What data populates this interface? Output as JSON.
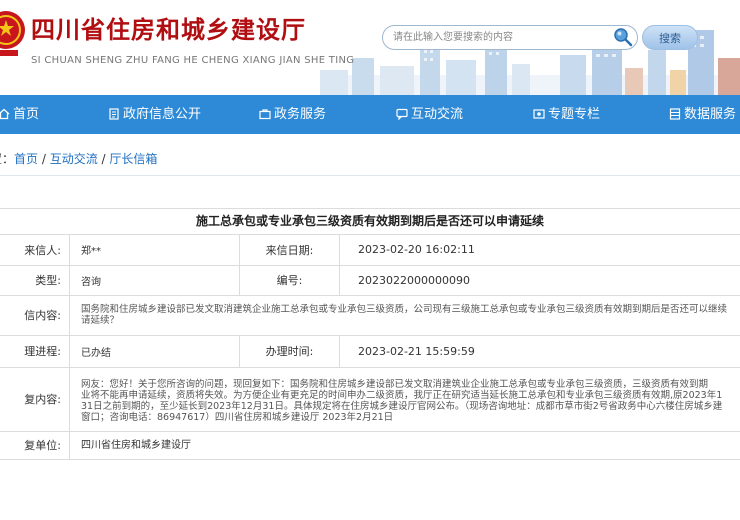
{
  "header": {
    "title": "四川省住房和城乡建设厅",
    "pinyin": "SI CHUAN SHENG ZHU FANG HE CHENG XIANG JIAN SHE TING",
    "search_placeholder": "请在此输入您要搜索的内容",
    "search_button": "搜索"
  },
  "nav": [
    {
      "label": "首页",
      "icon": "home-icon"
    },
    {
      "label": "政府信息公开",
      "icon": "document-icon"
    },
    {
      "label": "政务服务",
      "icon": "briefcase-icon"
    },
    {
      "label": "互动交流",
      "icon": "chat-icon"
    },
    {
      "label": "专题专栏",
      "icon": "star-icon"
    },
    {
      "label": "数据服务",
      "icon": "database-icon"
    }
  ],
  "breadcrumb": {
    "prefix": "置：",
    "items": [
      "首页",
      "互动交流",
      "厅长信箱"
    ],
    "separator": " / "
  },
  "letter": {
    "title": "施工总承包或专业承包三级资质有效期到期后是否还可以申请延续",
    "sender_label": "来信人:",
    "sender": "郑**",
    "date_label": "来信日期:",
    "date": "2023-02-20 16:02:11",
    "type_label": "类型:",
    "type": "咨询",
    "number_label": "编号:",
    "number": "2023022000000090",
    "content_label": "信内容:",
    "content": "国务院和住房城乡建设部已发文取消建筑企业施工总承包或专业承包三级资质，公司现有三级施工总承包或专业承包三级资质有效期到期后是否还可以继续\n请延续？",
    "process_label": "理进程:",
    "process": "已办结",
    "handle_time_label": "办理时间:",
    "handle_time": "2023-02-21 15:59:59",
    "reply_label": "复内容:",
    "reply": "网友：您好！关于您所咨询的问题，现回复如下：国务院和住房城乡建设部已发文取消建筑业企业施工总承包或专业承包三级资质，三级资质有效到期\n业将不能再申请延续，资质将失效。为方便企业有更充足的时间申办二级资质，我厅正在研究适当延长施工总承包和专业承包三级资质有效期,原2023年1\n31日之前到期的，至少延长到2023年12月31日。具体规定将在住房城乡建设厅官网公布。（现场咨询地址：成都市草市街2号省政务中心六楼住房城乡建\n窗口；咨询电话：86947617）四川省住房和城乡建设厅 2023年2月21日",
    "unit_label": "复单位:",
    "unit": "四川省住房和城乡建设厅"
  },
  "colors": {
    "nav_bg": "#2e8ad6",
    "title_red": "#b10e12",
    "link_blue": "#2270c0"
  }
}
